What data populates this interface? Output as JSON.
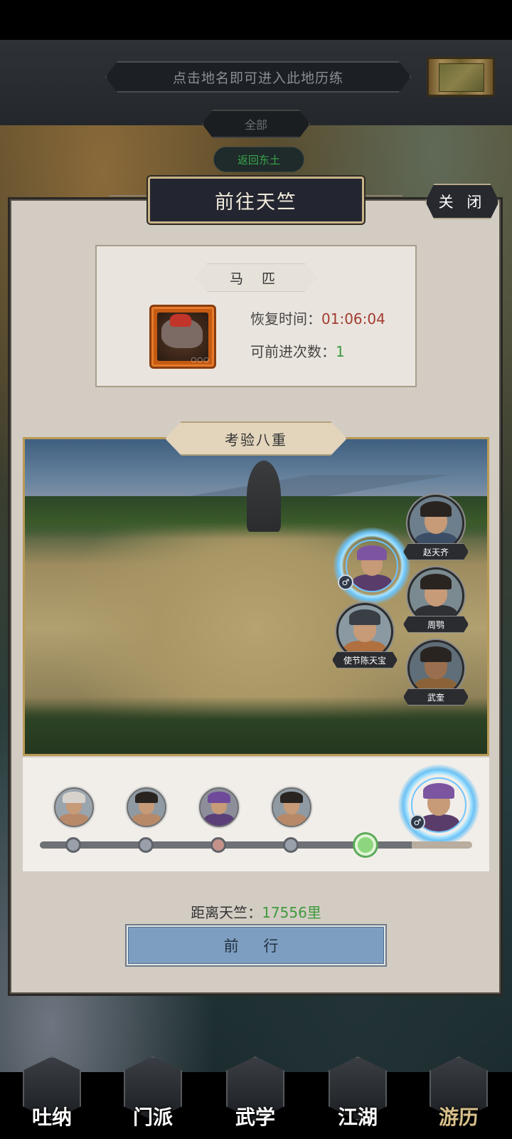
{
  "header": {
    "hint": "点击地名即可进入此地历练",
    "filter_all": "全部",
    "return_label": "返回东土"
  },
  "panel": {
    "title": "前往天竺",
    "close_label": "关 闭"
  },
  "horse": {
    "tag": "马 匹",
    "recover_label": "恢复时间：",
    "recover_time": "01:06:04",
    "remaining_label": "可前进次数：",
    "remaining_count": "1",
    "icon_dots": "○○○"
  },
  "trial": {
    "title": "考验八重",
    "npcs": [
      {
        "name": "赵天齐"
      },
      {
        "name": "周鹗"
      },
      {
        "name": "使节陈天宝"
      },
      {
        "name": "武奎"
      }
    ],
    "hero_gender": "♂"
  },
  "progress": {
    "fill_fraction": 0.86,
    "current_stop_index": 4,
    "stops": 5
  },
  "travel": {
    "distance_label": "距离天竺：",
    "distance_value": "17556里",
    "go_label": "前 行"
  },
  "nav": {
    "tabs": [
      {
        "label": "吐纳"
      },
      {
        "label": "门派"
      },
      {
        "label": "武学"
      },
      {
        "label": "江湖"
      },
      {
        "label": "游历"
      }
    ],
    "active_index": 4
  },
  "colors": {
    "accent_green": "#3c9a3f",
    "timer_red": "#a33b2f",
    "button_blue": "#7d9ec0",
    "title_gold": "#c9b488"
  }
}
